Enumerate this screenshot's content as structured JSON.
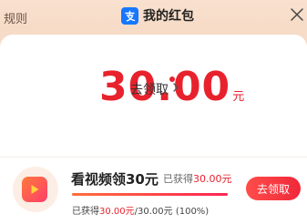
{
  "header": {
    "rules_label": "规则",
    "title": "我的红包",
    "app_icon": "alipay-icon",
    "close_icon": "close-icon"
  },
  "balance": {
    "amount": "30.00",
    "unit": "元",
    "claim_label": "去领取",
    "chevron": "›"
  },
  "task": {
    "title": "看视频领30元",
    "earned_prefix": "已获得",
    "earned_value": "30.00元",
    "progress_fraction": 1.0,
    "detail_prefix": "已获得",
    "detail_value": "30.00元",
    "detail_total": "/30.00元 (100%)",
    "button_label": "去领取",
    "icon": "video-play-icon"
  },
  "colors": {
    "accent": "#e8222d",
    "background": "#f6dcc8"
  }
}
